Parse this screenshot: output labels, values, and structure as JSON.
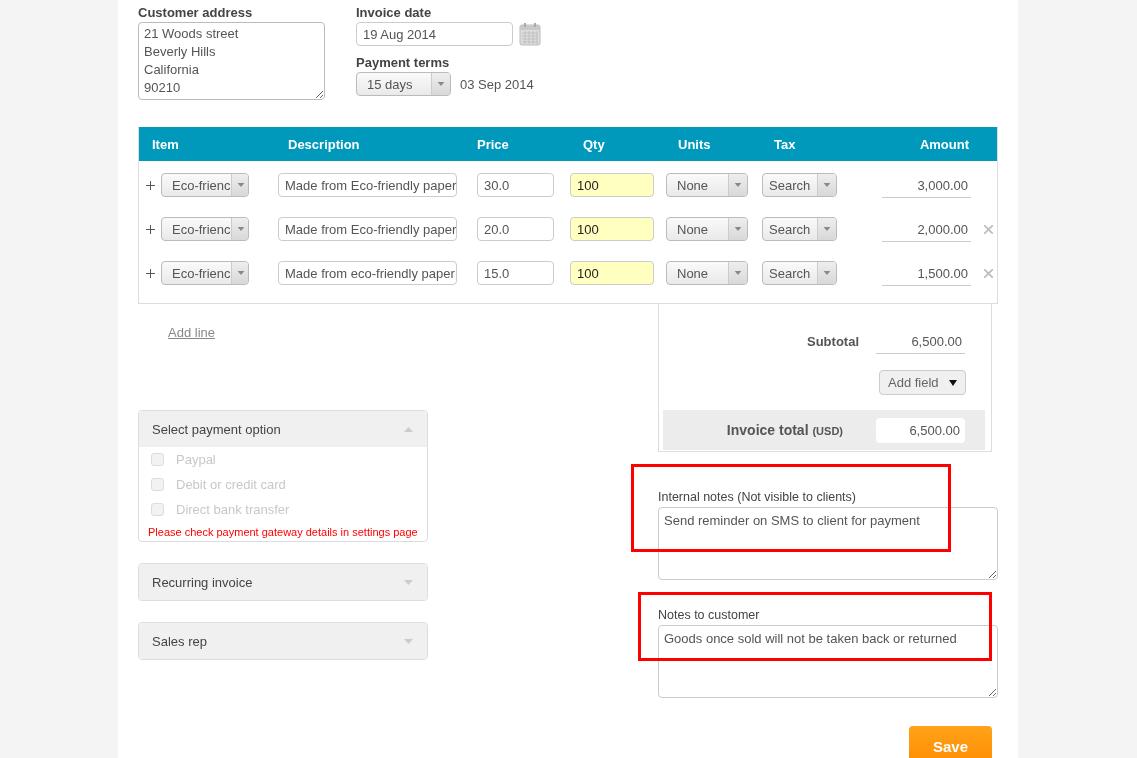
{
  "customer_address": {
    "label": "Customer address",
    "lines": [
      "21 Woods street",
      "Beverly Hills",
      "California",
      "90210"
    ]
  },
  "invoice_date": {
    "label": "Invoice date",
    "value": "19 Aug 2014"
  },
  "payment_terms": {
    "label": "Payment terms",
    "value": "15 days",
    "due_date": "03 Sep 2014"
  },
  "table": {
    "columns": [
      "Item",
      "Description",
      "Price",
      "Qty",
      "Units",
      "Tax",
      "Amount"
    ],
    "rows": [
      {
        "item": "Eco-frienc",
        "description": "Made from Eco-friendly paper",
        "price": "30.0",
        "qty": "100",
        "qty_highlighted": true,
        "units": "None",
        "tax": "Search",
        "amount": "3,000.00",
        "removable": false
      },
      {
        "item": "Eco-frienc",
        "description": "Made from Eco-friendly paper",
        "price": "20.0",
        "qty": "100",
        "qty_highlighted": true,
        "units": "None",
        "tax": "Search",
        "amount": "2,000.00",
        "removable": true
      },
      {
        "item": "Eco-frienc",
        "description": "Made from eco-friendly paper",
        "price": "15.0",
        "qty": "100",
        "qty_highlighted": true,
        "units": "None",
        "tax": "Search",
        "amount": "1,500.00",
        "removable": true
      }
    ]
  },
  "add_line": "Add line",
  "totals": {
    "subtotal_label": "Subtotal",
    "subtotal": "6,500.00",
    "add_field": "Add field",
    "total_label": "Invoice total",
    "currency": "(USD)",
    "total": "6,500.00"
  },
  "panels": [
    {
      "title": "Select payment option",
      "expanded": true,
      "options": [
        {
          "label": "Paypal",
          "checked": false,
          "disabled": true
        },
        {
          "label": "Debit or credit card",
          "checked": false,
          "disabled": true
        },
        {
          "label": "Direct bank transfer",
          "checked": false,
          "disabled": true
        }
      ],
      "warning": "Please check payment gateway details in settings page"
    },
    {
      "title": "Recurring invoice",
      "expanded": false
    },
    {
      "title": "Sales rep",
      "expanded": false
    }
  ],
  "notes": [
    {
      "label": "Internal notes (Not visible to clients)",
      "value": "Send reminder on SMS to client for payment",
      "framed": true
    },
    {
      "label": "Notes to customer",
      "value": "Goods once sold will not be taken back or returned",
      "framed": true
    }
  ],
  "save": "Save"
}
